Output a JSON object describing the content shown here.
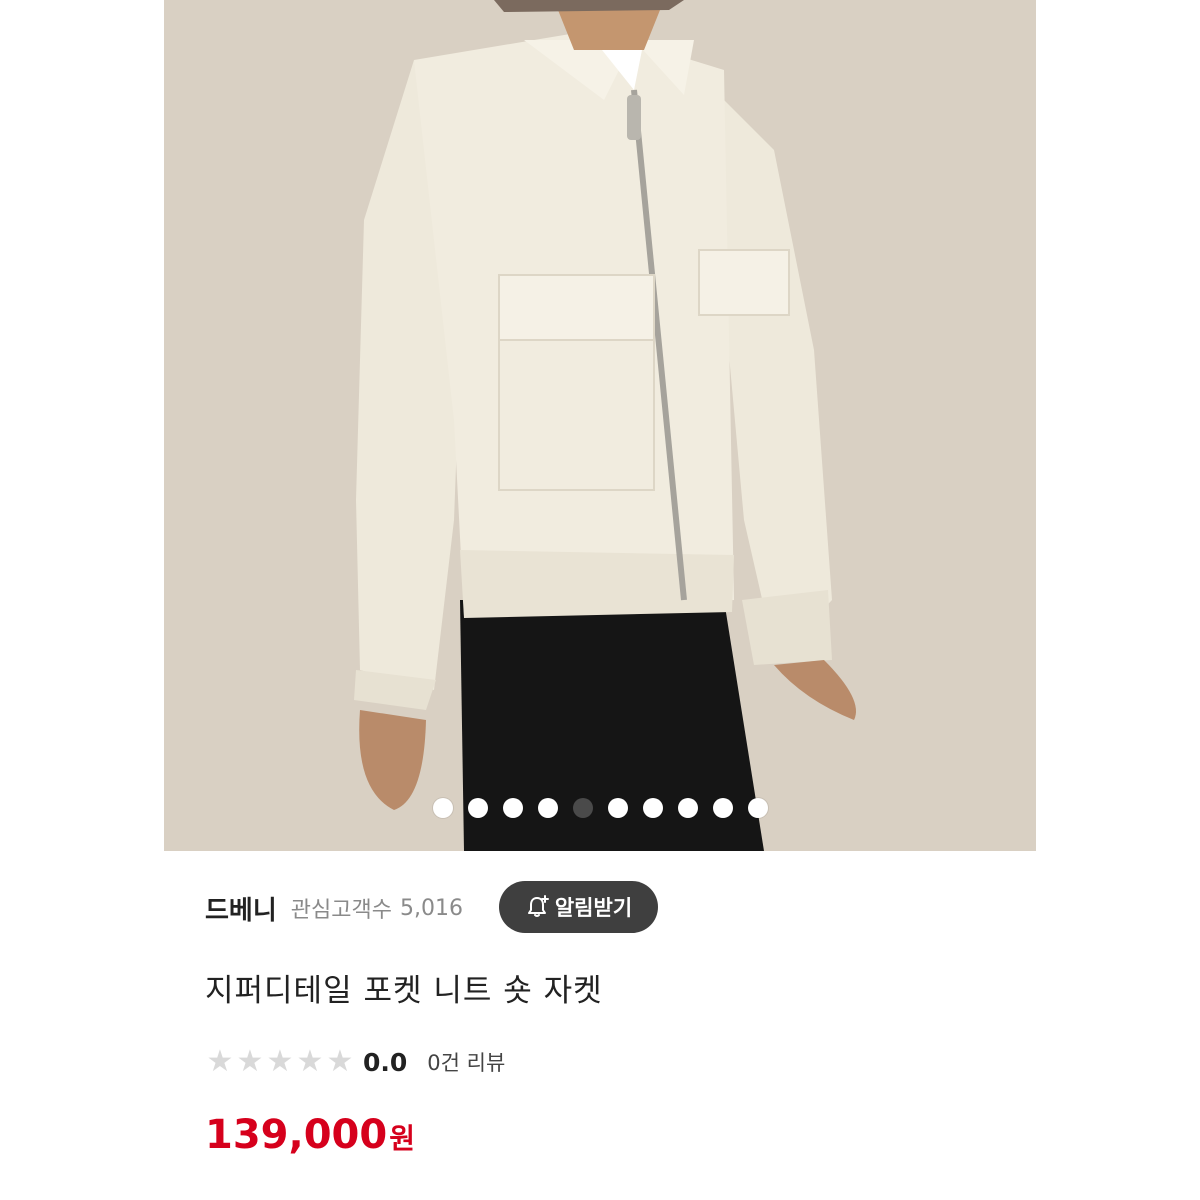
{
  "product_image": {
    "alt_icon": "product-photo",
    "pager": {
      "total": 10,
      "active_index": 4
    }
  },
  "brand": {
    "name": "드베니",
    "followers_label": "관심고객수",
    "followers_count": "5,016"
  },
  "notify_button": {
    "label": "알림받기",
    "icon": "bell-plus-icon"
  },
  "product": {
    "title": "지퍼디테일 포켓 니트 숏 자켓"
  },
  "rating": {
    "stars_filled": 0,
    "stars_total": 5,
    "score": "0.0",
    "review_label": "0건 리뷰"
  },
  "price": {
    "amount": "139,000",
    "currency": "원",
    "color": "#d6001c"
  }
}
